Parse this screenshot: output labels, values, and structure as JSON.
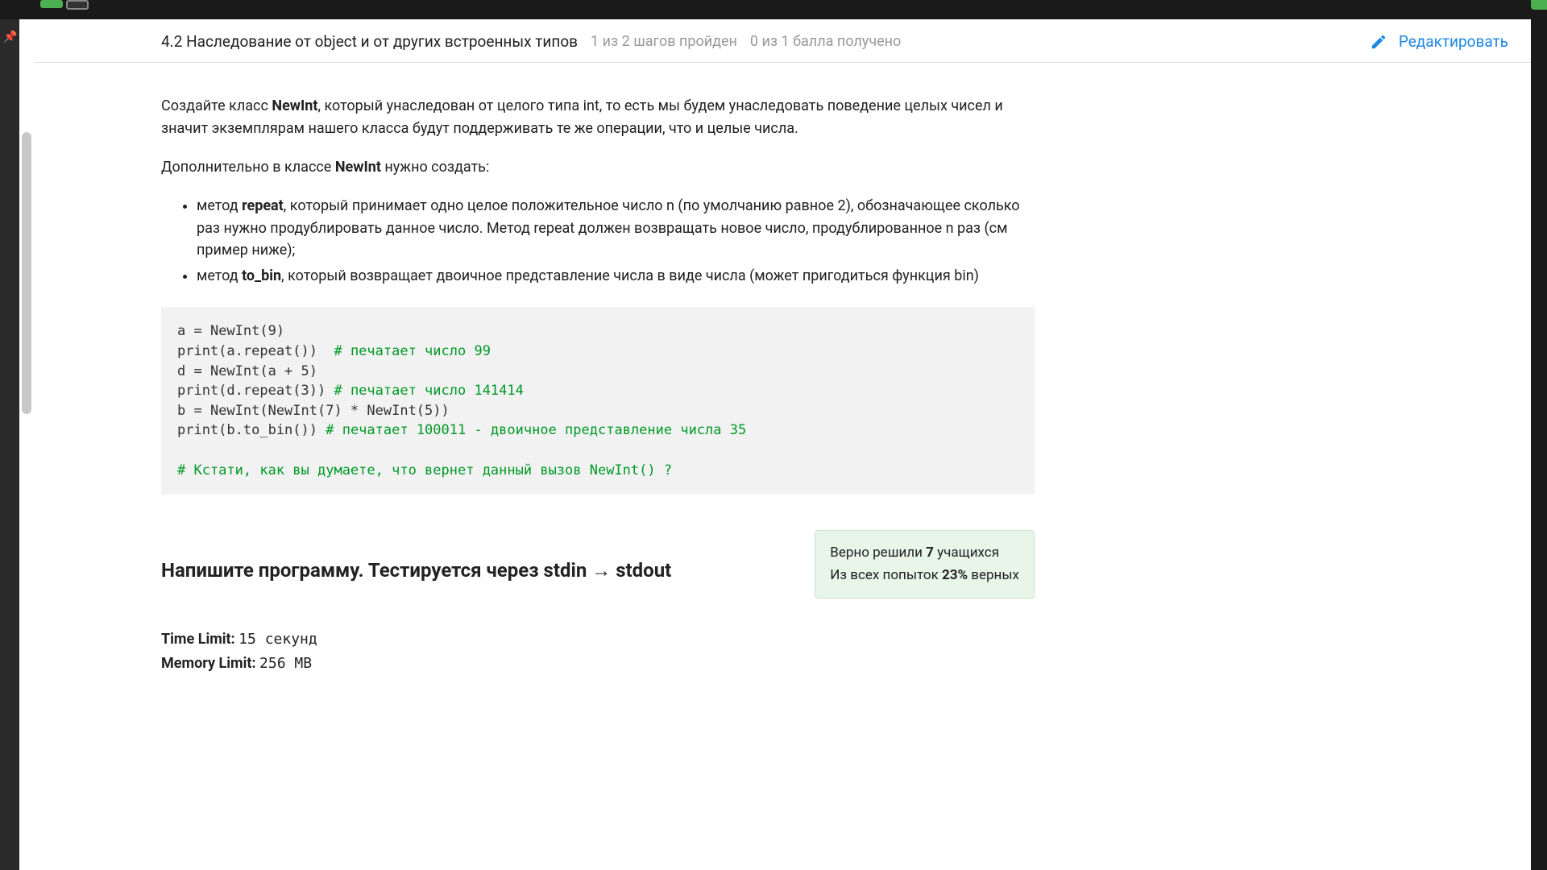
{
  "header": {
    "title": "4.2 Наследование от object и от других встроенных типов",
    "steps": "1 из 2 шагов пройден",
    "points": "0 из 1 балла  получено",
    "edit": "Редактировать"
  },
  "task": {
    "p1_a": "Создайте класс ",
    "p1_b": "NewInt",
    "p1_c": ", который унаследован от целого типа int, то есть мы будем унаследовать поведение целых чисел и значит экземплярам нашего класса будут поддерживать те же операции, что и целые числа.",
    "p2_a": "Дополнительно в классе ",
    "p2_b": "NewInt",
    "p2_c": " нужно создать:",
    "li1_a": "метод ",
    "li1_b": "repeat",
    "li1_c": ", который принимает одно целое положительное число n (по умолчанию равное 2), обозначающее сколько раз нужно продублировать данное число. Метод repeat должен возвращать новое число, продублированное n раз (см пример ниже);",
    "li2_a": "метод ",
    "li2_b": "to_bin",
    "li2_c": ", который возвращает двоичное представление числа в виде числа (может пригодиться функция bin)"
  },
  "code": {
    "l1": "a = NewInt(9)",
    "l2": "print(a.repeat())  ",
    "l2c": "# печатает число 99",
    "l3": "d = NewInt(a + 5)",
    "l4": "print(d.repeat(3)) ",
    "l4c": "# печатает число 141414",
    "l5": "b = NewInt(NewInt(7) * NewInt(5))",
    "l6": "print(b.to_bin()) ",
    "l6c": "# печатает 100011 - двоичное представление числа 35",
    "l7": "",
    "l8c": "# Кстати, как вы думаете, что вернет данный вызов NewInt() ?"
  },
  "heading": "Напишите программу. Тестируется через stdin → stdout",
  "stats": {
    "solved_a": "Верно решили ",
    "solved_b": "7",
    "solved_c": " учащихся",
    "tries_a": "Из всех попыток ",
    "tries_b": "23%",
    "tries_c": " верных"
  },
  "limits": {
    "tl_label": "Time Limit:",
    "tl_value": "15 секунд",
    "ml_label": "Memory Limit:",
    "ml_value": "256 MB"
  }
}
